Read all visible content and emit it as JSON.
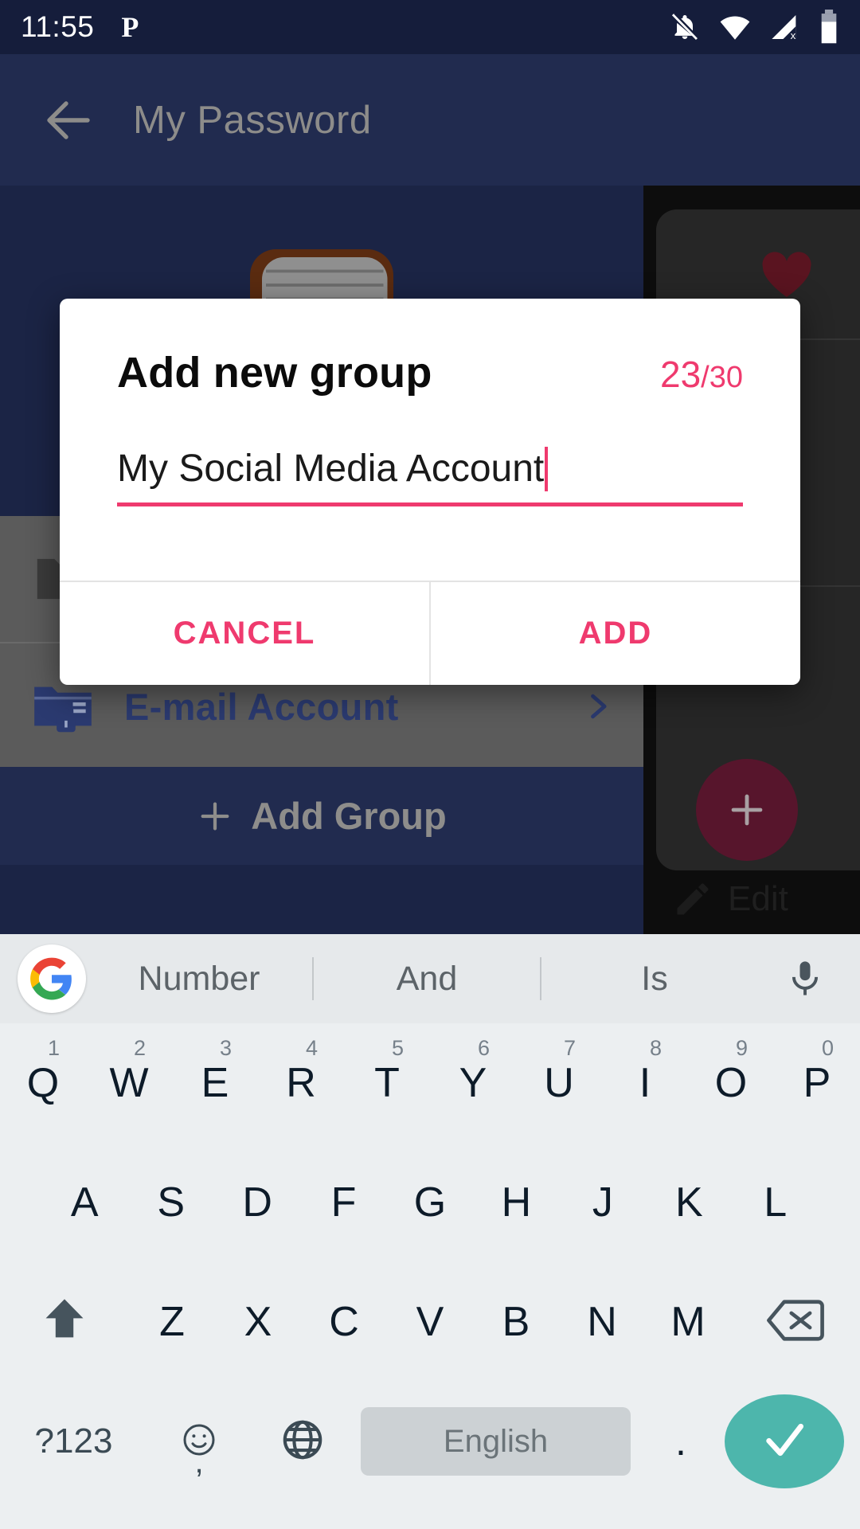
{
  "status_bar": {
    "time": "11:55",
    "app_badge": "P",
    "icons": [
      "notifications-off-icon",
      "wifi-icon",
      "cellular-off-icon",
      "battery-icon"
    ]
  },
  "app_bar": {
    "back_icon": "back-arrow-icon",
    "title": "My Password"
  },
  "background": {
    "book_illustration": "diary-book-illustration",
    "list_items": [
      {
        "icon": "folder-lock-icon",
        "label": ""
      },
      {
        "icon": "folder-lock-icon",
        "label": "E-mail Account",
        "chevron": "chevron-right-icon"
      }
    ],
    "add_group": {
      "icon": "plus-icon",
      "label": "Add Group"
    },
    "right_panel": {
      "fab": {
        "icon": "plus-icon"
      },
      "edit": {
        "icon": "pencil-icon",
        "label": "Edit"
      },
      "heart": "heart-icon"
    }
  },
  "dialog": {
    "title": "Add new group",
    "counter_current": "23",
    "counter_max": "/30",
    "input_value": "My Social Media Account",
    "input_placeholder": "",
    "cancel_label": "CANCEL",
    "add_label": "ADD",
    "accent_color": "#ef3a6e"
  },
  "keyboard": {
    "google_icon": "google-g-icon",
    "suggestions": [
      "Number",
      "And",
      "Is"
    ],
    "mic_icon": "microphone-icon",
    "row1": [
      {
        "key": "Q",
        "num": "1"
      },
      {
        "key": "W",
        "num": "2"
      },
      {
        "key": "E",
        "num": "3"
      },
      {
        "key": "R",
        "num": "4"
      },
      {
        "key": "T",
        "num": "5"
      },
      {
        "key": "Y",
        "num": "6"
      },
      {
        "key": "U",
        "num": "7"
      },
      {
        "key": "I",
        "num": "8"
      },
      {
        "key": "O",
        "num": "9"
      },
      {
        "key": "P",
        "num": "0"
      }
    ],
    "row2": [
      "A",
      "S",
      "D",
      "F",
      "G",
      "H",
      "J",
      "K",
      "L"
    ],
    "row3": {
      "shift_icon": "shift-icon",
      "keys": [
        "Z",
        "X",
        "C",
        "V",
        "B",
        "N",
        "M"
      ],
      "backspace_icon": "backspace-icon"
    },
    "row4": {
      "symbols_label": "?123",
      "emoji_icon": "emoji-icon",
      "comma": ",",
      "globe_icon": "globe-icon",
      "space_label": "English",
      "period": ".",
      "enter_icon": "checkmark-icon"
    }
  }
}
